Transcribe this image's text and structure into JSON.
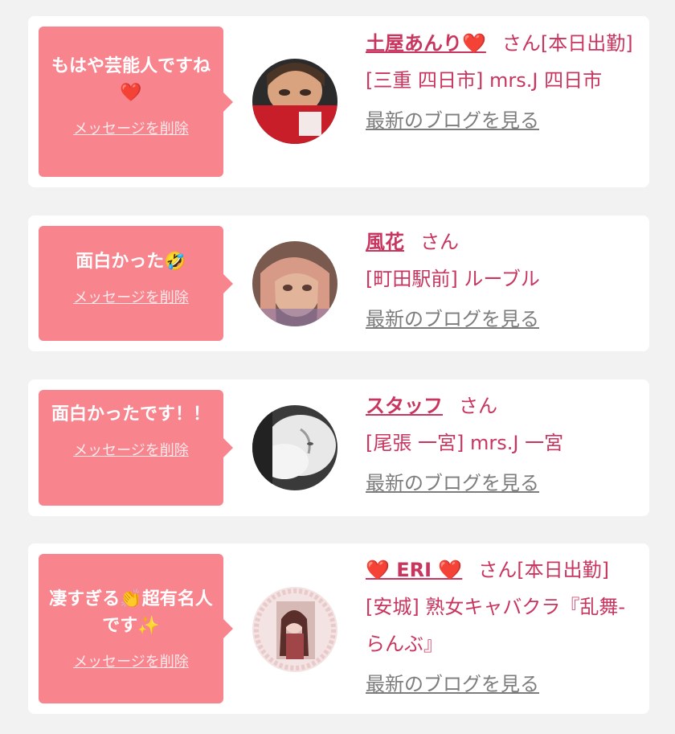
{
  "items": [
    {
      "message": "もはや芸能人ですね❤️",
      "delete_label": "メッセージを削除",
      "name": "土屋あんり❤️",
      "suffix": "さん[本日出勤]",
      "shop": "[三重 四日市] mrs.J 四日市",
      "blog_link": "最新のブログを見る",
      "avatar": "woman-with-red-book-photo"
    },
    {
      "message": "面白かった🤣",
      "delete_label": "メッセージを削除",
      "name": "風花",
      "suffix": "さん",
      "shop": "[町田駅前] ルーブル",
      "blog_link": "最新のブログを見る",
      "avatar": "woman-selfie-photo"
    },
    {
      "message": "面白かったです！！",
      "delete_label": "メッセージを削除",
      "name": "スタッフ",
      "suffix": "さん",
      "shop": "[尾張 一宮] mrs.J 一宮",
      "blog_link": "最新のブログを見る",
      "avatar": "white-cat-photo"
    },
    {
      "message": "凄すぎる👏超有名人です✨",
      "delete_label": "メッセージを削除",
      "name": "❤️ ERI ❤️",
      "suffix": "さん[本日出勤]",
      "shop": "[安城] 熟女キャバクラ『乱舞-らんぶ』",
      "blog_link": "最新のブログを見る",
      "avatar": "woman-lace-frame-photo"
    }
  ],
  "colors": {
    "bubble": "#f8848e",
    "name": "#c8365f",
    "link_gray": "#7d7d7d"
  }
}
